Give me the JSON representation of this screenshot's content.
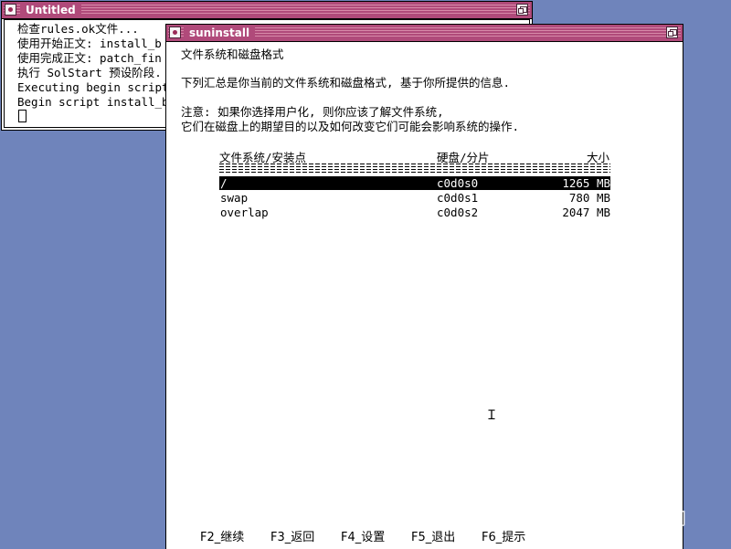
{
  "terminal": {
    "title": "Untitled",
    "lines": [
      "检查rules.ok文件...",
      "使用开始正文: install_b",
      "使用完成正文: patch_fin",
      "执行 SolStart 预设阶段.",
      "Executing begin script",
      "Begin script install_be"
    ]
  },
  "suninstall": {
    "title": "suninstall",
    "heading": "文件系统和磁盘格式",
    "summary": "下列汇总是你当前的文件系统和磁盘格式, 基于你所提供的信息.",
    "note_line1": "注意: 如果你选择用户化, 则你应该了解文件系统,",
    "note_line2": "它们在磁盘上的期望目的以及如何改变它们可能会影响系统的操作.",
    "columns": {
      "mount": "文件系统/安装点",
      "disk": "硬盘/分片",
      "size": "大小"
    },
    "rows": [
      {
        "mount": "/",
        "disk": "c0d0s0",
        "size": "1265 MB"
      },
      {
        "mount": "swap",
        "disk": "c0d0s1",
        "size": "780 MB"
      },
      {
        "mount": "overlap",
        "disk": "c0d0s2",
        "size": "2047 MB"
      }
    ],
    "fkeys": [
      {
        "label": "F2_继续"
      },
      {
        "label": "F3_返回"
      },
      {
        "label": "F4_设置"
      },
      {
        "label": "F5_退出"
      },
      {
        "label": "F6_提示"
      }
    ]
  },
  "watermark": "知乎 @穿越时间",
  "colors": {
    "desktop": "#6f84bb",
    "titlebar": "#b04a7a",
    "selection": "#000000"
  }
}
